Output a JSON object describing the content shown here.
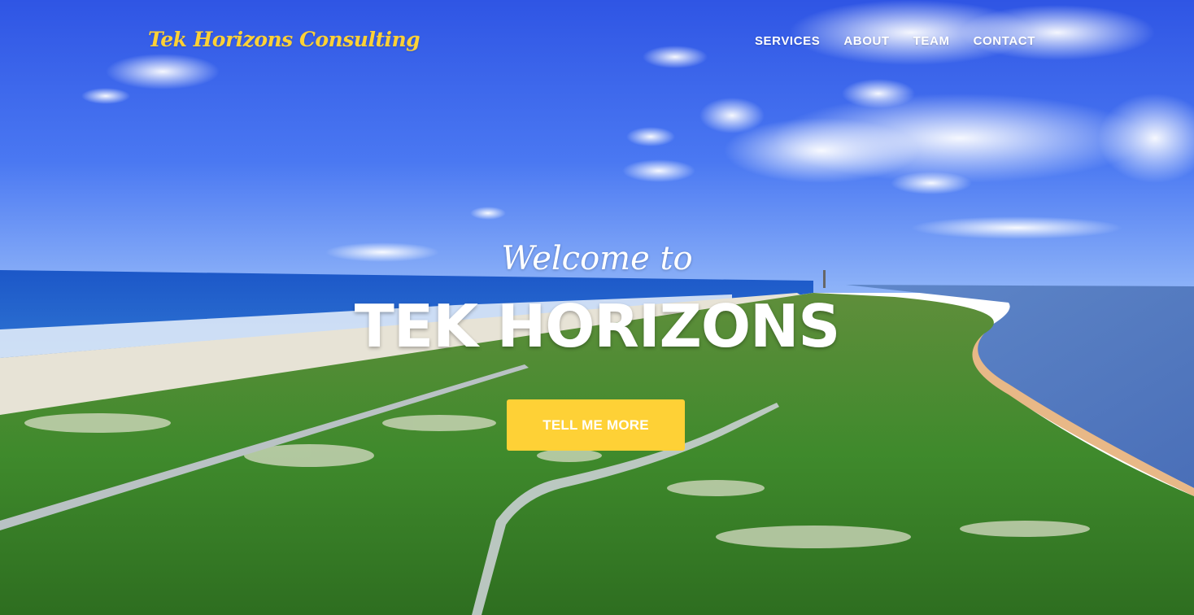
{
  "navbar": {
    "brand": "Tek Horizons Consulting",
    "links": [
      "Services",
      "About",
      "Team",
      "Contact"
    ]
  },
  "hero": {
    "lead": "Welcome to",
    "heading": "TEK HORIZONS",
    "cta_label": "TELL ME MORE"
  },
  "colors": {
    "accent": "#fed136",
    "text_light": "#ffffff"
  }
}
